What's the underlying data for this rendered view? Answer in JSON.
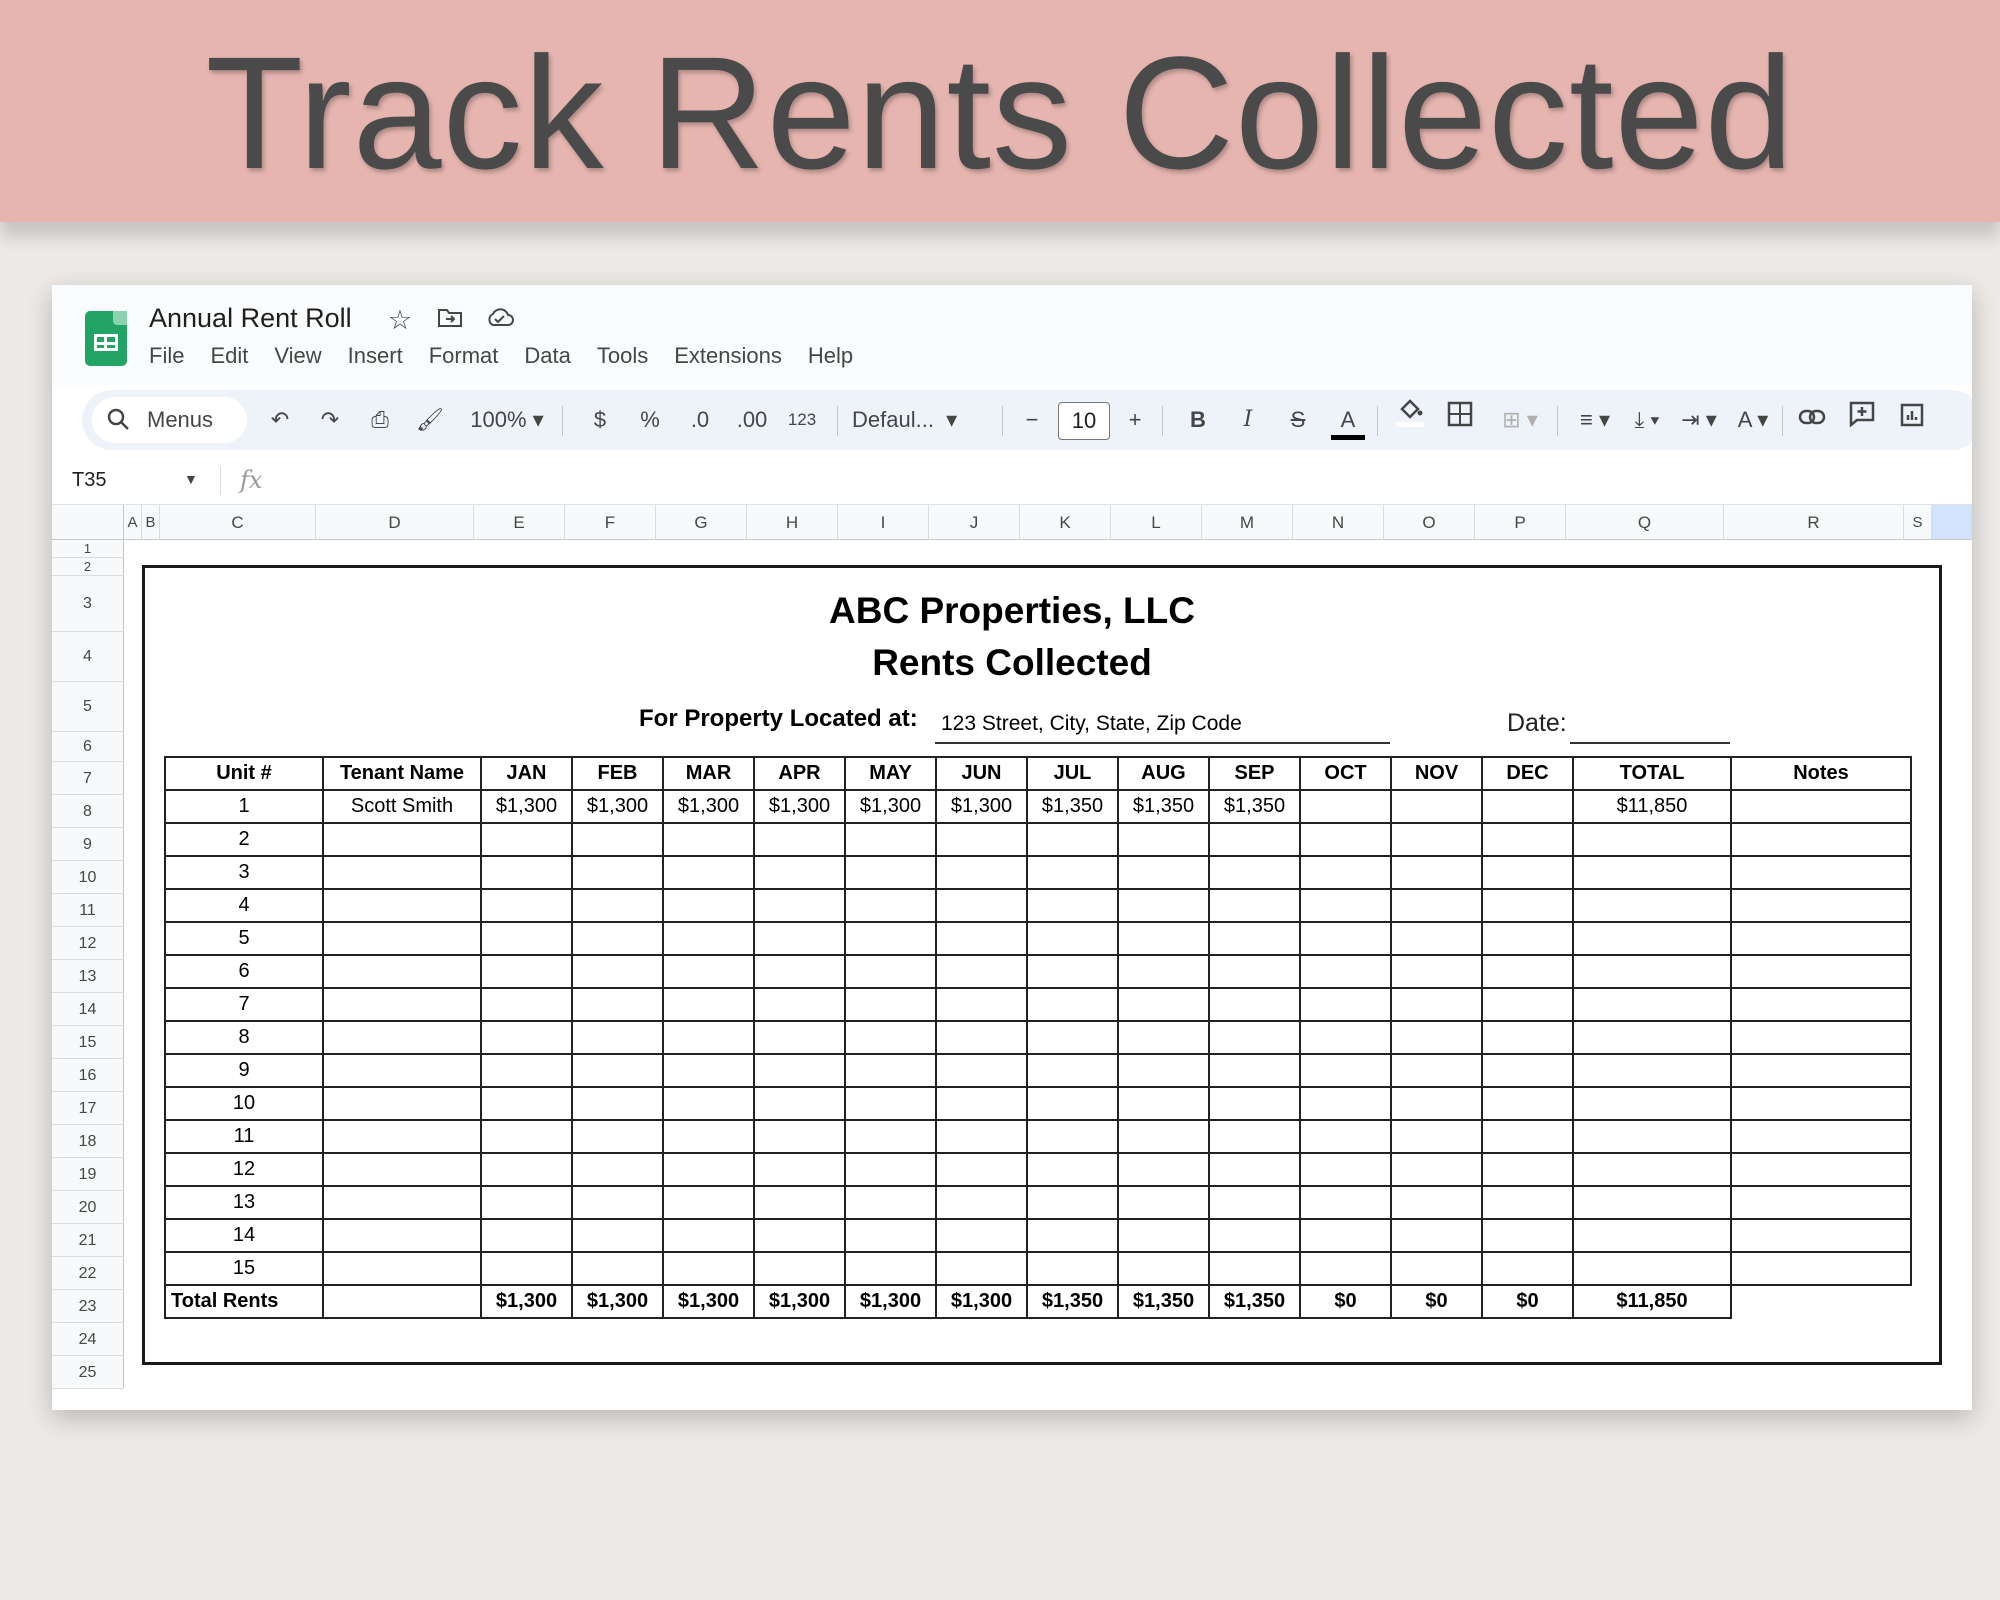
{
  "banner": {
    "title": "Track Rents Collected"
  },
  "app": {
    "doc_title": "Annual Rent Roll",
    "menu": [
      "File",
      "Edit",
      "View",
      "Insert",
      "Format",
      "Data",
      "Tools",
      "Extensions",
      "Help"
    ]
  },
  "toolbar": {
    "search_label": "Menus",
    "zoom": "100%",
    "currency": "$",
    "percent": "%",
    "dec_decrease": ".0",
    "dec_increase": ".00",
    "number_format": "123",
    "font": "Defaul...",
    "font_size": "10",
    "bold": "B",
    "italic": "I"
  },
  "formula_bar": {
    "name_box": "T35",
    "fx": "fx"
  },
  "columns": [
    "A",
    "B",
    "C",
    "D",
    "E",
    "F",
    "G",
    "H",
    "I",
    "J",
    "K",
    "L",
    "M",
    "N",
    "O",
    "P",
    "Q",
    "R",
    "S"
  ],
  "rows": [
    "1",
    "2",
    "3",
    "4",
    "5",
    "6",
    "7",
    "8",
    "9",
    "10",
    "11",
    "12",
    "13",
    "14",
    "15",
    "16",
    "17",
    "18",
    "19",
    "20",
    "21",
    "22",
    "23",
    "24",
    "25"
  ],
  "sheet": {
    "company": "ABC Properties, LLC",
    "subtitle": "Rents Collected",
    "property_label": "For Property Located at:",
    "address": "123 Street, City, State, Zip Code",
    "date_label": "Date:",
    "headers": [
      "Unit #",
      "Tenant Name",
      "JAN",
      "FEB",
      "MAR",
      "APR",
      "MAY",
      "JUN",
      "JUL",
      "AUG",
      "SEP",
      "OCT",
      "NOV",
      "DEC",
      "TOTAL",
      "Notes"
    ],
    "rows": [
      [
        "1",
        "Scott Smith",
        "$1,300",
        "$1,300",
        "$1,300",
        "$1,300",
        "$1,300",
        "$1,300",
        "$1,350",
        "$1,350",
        "$1,350",
        "",
        "",
        "",
        "$11,850",
        ""
      ],
      [
        "2",
        "",
        "",
        "",
        "",
        "",
        "",
        "",
        "",
        "",
        "",
        "",
        "",
        "",
        "",
        ""
      ],
      [
        "3",
        "",
        "",
        "",
        "",
        "",
        "",
        "",
        "",
        "",
        "",
        "",
        "",
        "",
        "",
        ""
      ],
      [
        "4",
        "",
        "",
        "",
        "",
        "",
        "",
        "",
        "",
        "",
        "",
        "",
        "",
        "",
        "",
        ""
      ],
      [
        "5",
        "",
        "",
        "",
        "",
        "",
        "",
        "",
        "",
        "",
        "",
        "",
        "",
        "",
        "",
        ""
      ],
      [
        "6",
        "",
        "",
        "",
        "",
        "",
        "",
        "",
        "",
        "",
        "",
        "",
        "",
        "",
        "",
        ""
      ],
      [
        "7",
        "",
        "",
        "",
        "",
        "",
        "",
        "",
        "",
        "",
        "",
        "",
        "",
        "",
        "",
        ""
      ],
      [
        "8",
        "",
        "",
        "",
        "",
        "",
        "",
        "",
        "",
        "",
        "",
        "",
        "",
        "",
        "",
        ""
      ],
      [
        "9",
        "",
        "",
        "",
        "",
        "",
        "",
        "",
        "",
        "",
        "",
        "",
        "",
        "",
        "",
        ""
      ],
      [
        "10",
        "",
        "",
        "",
        "",
        "",
        "",
        "",
        "",
        "",
        "",
        "",
        "",
        "",
        "",
        ""
      ],
      [
        "11",
        "",
        "",
        "",
        "",
        "",
        "",
        "",
        "",
        "",
        "",
        "",
        "",
        "",
        "",
        ""
      ],
      [
        "12",
        "",
        "",
        "",
        "",
        "",
        "",
        "",
        "",
        "",
        "",
        "",
        "",
        "",
        "",
        ""
      ],
      [
        "13",
        "",
        "",
        "",
        "",
        "",
        "",
        "",
        "",
        "",
        "",
        "",
        "",
        "",
        "",
        ""
      ],
      [
        "14",
        "",
        "",
        "",
        "",
        "",
        "",
        "",
        "",
        "",
        "",
        "",
        "",
        "",
        "",
        ""
      ],
      [
        "15",
        "",
        "",
        "",
        "",
        "",
        "",
        "",
        "",
        "",
        "",
        "",
        "",
        "",
        "",
        ""
      ]
    ],
    "total_label": "Total Rents",
    "totals": [
      "$1,300",
      "$1,300",
      "$1,300",
      "$1,300",
      "$1,300",
      "$1,300",
      "$1,350",
      "$1,350",
      "$1,350",
      "$0",
      "$0",
      "$0",
      "$11,850"
    ]
  }
}
